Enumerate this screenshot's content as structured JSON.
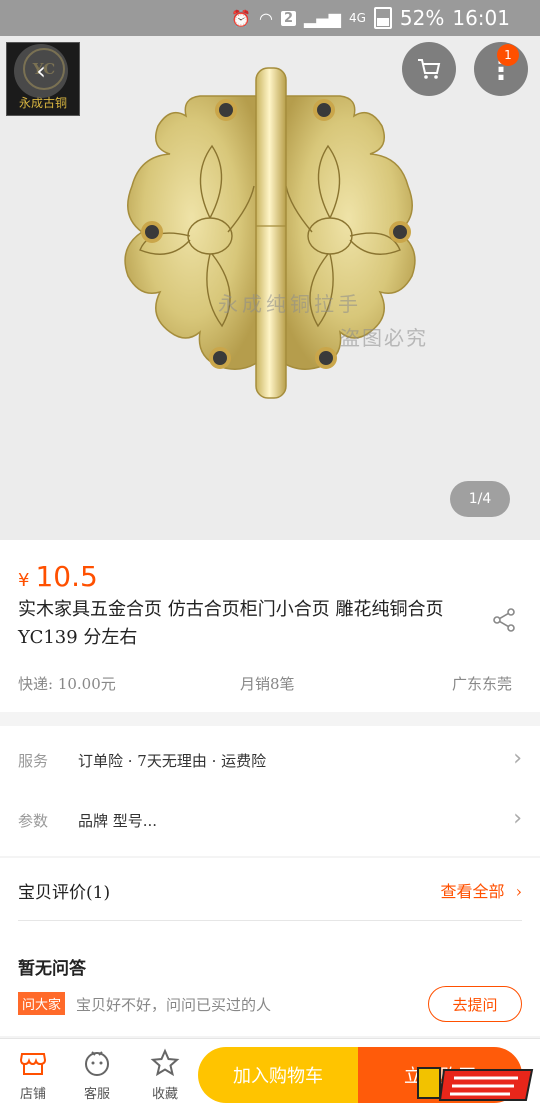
{
  "status_bar": {
    "notif_count": "2",
    "network": "4G",
    "battery": "52%",
    "time": "16:01"
  },
  "hero": {
    "logo_initials": "YC",
    "logo_name": "永成古铜",
    "watermark_line1": "永成纯铜拉手",
    "watermark_line2": "盗图必究",
    "pager": "1/4",
    "cart_badge": "1",
    "icons": {
      "back": "back-arrow-icon",
      "cart": "cart-icon",
      "more": "more-vertical-icon"
    }
  },
  "product": {
    "currency": "¥",
    "price": "10.5",
    "title": "实木家具五金合页 仿古合页柜门小合页 雕花纯铜合页YC139 分左右",
    "shipping": "快递: 10.00元",
    "monthly_sales": "月销8笔",
    "location": "广东东莞"
  },
  "services": [
    {
      "label": "服务",
      "value": "订单险 · 7天无理由 · 运费险"
    },
    {
      "label": "参数",
      "value": "品牌 型号..."
    }
  ],
  "reviews": {
    "title": "宝贝评价(1)",
    "view_all": "查看全部",
    "qa_title": "暂无问答",
    "qa_tag": "问大家",
    "qa_hint": "宝贝好不好，问问已买过的人",
    "ask_button": "去提问"
  },
  "bottom_bar": {
    "shop": "店铺",
    "service": "客服",
    "favorite": "收藏",
    "add_to_cart": "加入购物车",
    "buy_now": "立即购买"
  },
  "colors": {
    "accent": "#ff5000",
    "cart_button": "#ffc400",
    "buy_button": "#ff5b0a",
    "brass": "#d8c77a"
  }
}
